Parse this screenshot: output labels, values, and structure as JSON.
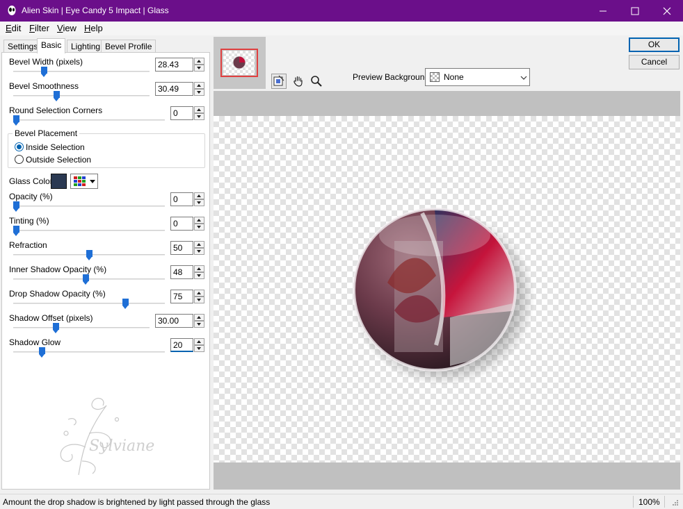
{
  "window": {
    "title": "Alien Skin | Eye Candy 5 Impact | Glass",
    "titlebar_color": "#6b0f8a"
  },
  "menu": [
    {
      "label": "Edit",
      "accel": "E",
      "rest": "dit"
    },
    {
      "label": "Filter",
      "accel": "F",
      "rest": "ilter"
    },
    {
      "label": "View",
      "accel": "V",
      "rest": "iew"
    },
    {
      "label": "Help",
      "accel": "H",
      "rest": "elp"
    }
  ],
  "tabs": [
    {
      "label": "Settings",
      "active": false
    },
    {
      "label": "Basic",
      "active": true
    },
    {
      "label": "Lighting",
      "active": false
    },
    {
      "label": "Bevel Profile",
      "active": false
    }
  ],
  "controls": {
    "bevel_width": {
      "label": "Bevel Width (pixels)",
      "value": "28.43"
    },
    "bevel_smoothness": {
      "label": "Bevel Smoothness",
      "value": "30.49"
    },
    "round_corners": {
      "label": "Round Selection Corners",
      "value": "0"
    },
    "bevel_placement": {
      "label": "Bevel Placement",
      "options": [
        "Inside Selection",
        "Outside Selection"
      ],
      "selected": "Inside Selection"
    },
    "glass_color": {
      "label": "Glass Color",
      "color": "#2b3952"
    },
    "opacity": {
      "label": "Opacity (%)",
      "value": "0"
    },
    "tinting": {
      "label": "Tinting (%)",
      "value": "0"
    },
    "refraction": {
      "label": "Refraction",
      "value": "50"
    },
    "inner_shadow_opacity": {
      "label": "Inner Shadow Opacity (%)",
      "value": "48"
    },
    "drop_shadow_opacity": {
      "label": "Drop Shadow Opacity (%)",
      "value": "75"
    },
    "shadow_offset": {
      "label": "Shadow Offset (pixels)",
      "value": "30.00"
    },
    "shadow_glow": {
      "label": "Shadow Glow",
      "value": "20"
    }
  },
  "preview": {
    "background_label": "Preview Background:",
    "background_value": "None"
  },
  "buttons": {
    "ok": "OK",
    "cancel": "Cancel"
  },
  "watermark": {
    "text": "Sylviane"
  },
  "status": {
    "text": "Amount the drop shadow is brightened by light passed through the glass",
    "zoom": "100%"
  },
  "accent_color": "#1f6fd6"
}
